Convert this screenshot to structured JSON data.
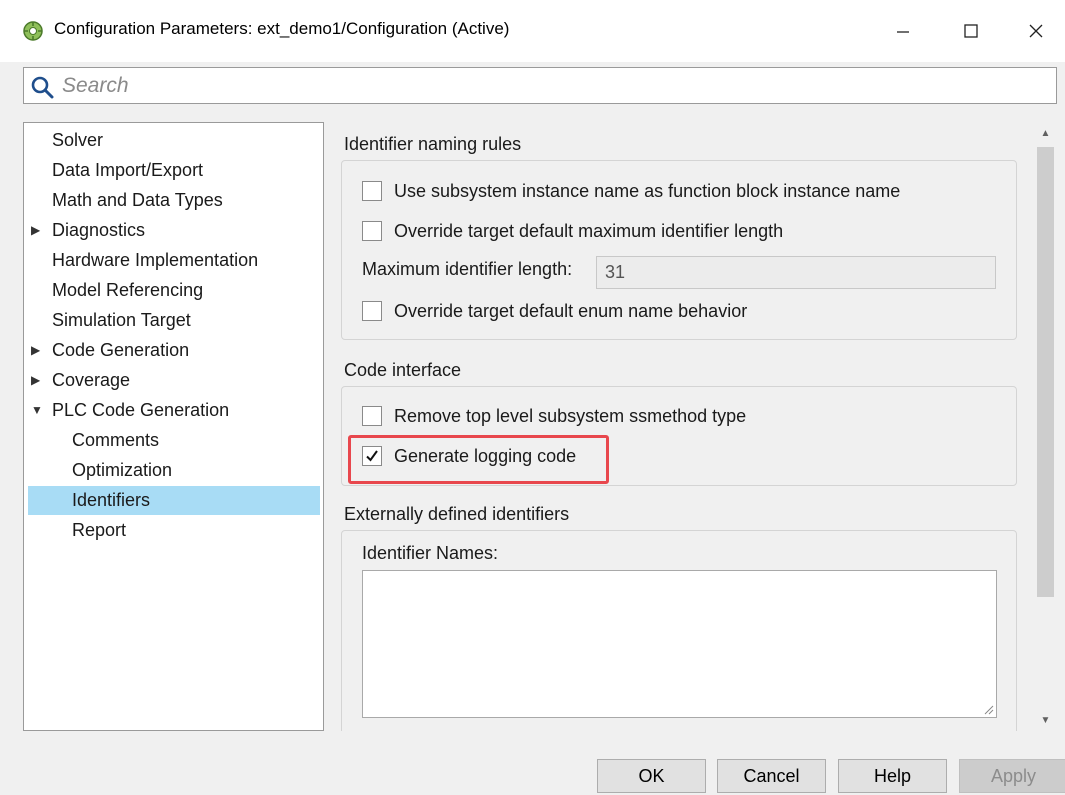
{
  "window": {
    "title": "Configuration Parameters: ext_demo1/Configuration (Active)",
    "minimize_glyph": "—",
    "maximize_glyph": "☐",
    "close_glyph": "✕"
  },
  "search": {
    "placeholder": "Search",
    "value": ""
  },
  "tree": {
    "items": [
      {
        "label": "Solver",
        "indent": 0,
        "arrow": ""
      },
      {
        "label": "Data Import/Export",
        "indent": 0,
        "arrow": ""
      },
      {
        "label": "Math and Data Types",
        "indent": 0,
        "arrow": ""
      },
      {
        "label": "Diagnostics",
        "indent": 0,
        "arrow": "▶"
      },
      {
        "label": "Hardware Implementation",
        "indent": 0,
        "arrow": ""
      },
      {
        "label": "Model Referencing",
        "indent": 0,
        "arrow": ""
      },
      {
        "label": "Simulation Target",
        "indent": 0,
        "arrow": ""
      },
      {
        "label": "Code Generation",
        "indent": 0,
        "arrow": "▶"
      },
      {
        "label": "Coverage",
        "indent": 0,
        "arrow": "▶"
      },
      {
        "label": "PLC Code Generation",
        "indent": 0,
        "arrow": "▼"
      },
      {
        "label": "Comments",
        "indent": 1,
        "arrow": ""
      },
      {
        "label": "Optimization",
        "indent": 1,
        "arrow": ""
      },
      {
        "label": "Identifiers",
        "indent": 1,
        "arrow": "",
        "selected": true
      },
      {
        "label": "Report",
        "indent": 1,
        "arrow": ""
      }
    ]
  },
  "identifier_naming": {
    "title": "Identifier naming rules",
    "use_subsystem_instance_name": {
      "label": "Use subsystem instance name as function block instance name",
      "checked": false
    },
    "override_max_length": {
      "label": "Override target default maximum identifier length",
      "checked": false
    },
    "max_length": {
      "label": "Maximum identifier length:",
      "value": "31"
    },
    "override_enum_name": {
      "label": "Override target default enum name behavior",
      "checked": false
    }
  },
  "code_interface": {
    "title": "Code interface",
    "remove_ssmethod": {
      "label": "Remove top level subsystem ssmethod type",
      "checked": false
    },
    "generate_logging": {
      "label": "Generate logging code",
      "checked": true
    }
  },
  "external_identifiers": {
    "title": "Externally defined identifiers",
    "names_label": "Identifier Names:",
    "names_value": ""
  },
  "scrollbar": {
    "up_glyph": "▲",
    "down_glyph": "▼"
  },
  "buttons": {
    "ok": "OK",
    "cancel": "Cancel",
    "help": "Help",
    "apply": "Apply"
  },
  "colors": {
    "selection": "#a8dcf5",
    "highlight": "#e8474d",
    "background": "#f0f0f0"
  }
}
